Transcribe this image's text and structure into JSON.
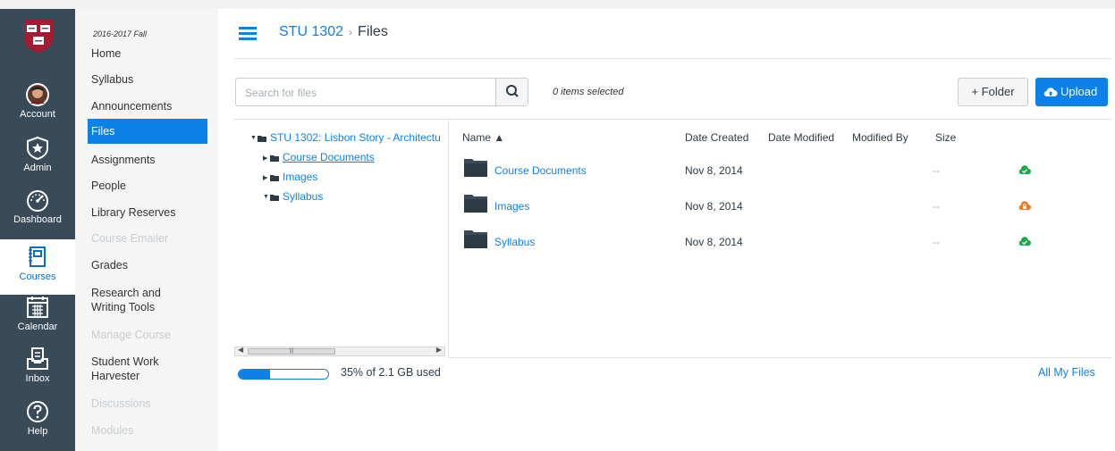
{
  "global_nav": {
    "items": [
      {
        "label": "Account",
        "icon": "avatar"
      },
      {
        "label": "Admin",
        "icon": "shield-star-icon"
      },
      {
        "label": "Dashboard",
        "icon": "speedometer-icon"
      },
      {
        "label": "Courses",
        "icon": "book-icon",
        "active": true
      },
      {
        "label": "Calendar",
        "icon": "calendar-icon"
      },
      {
        "label": "Inbox",
        "icon": "inbox-icon"
      },
      {
        "label": "Help",
        "icon": "help-icon"
      }
    ],
    "logo_text": "VE RI TAS"
  },
  "course_nav": {
    "term": "2016-2017 Fall",
    "items": [
      {
        "label": "Home"
      },
      {
        "label": "Syllabus"
      },
      {
        "label": "Announcements"
      },
      {
        "label": "Files",
        "active": true
      },
      {
        "label": "Assignments"
      },
      {
        "label": "People"
      },
      {
        "label": "Library Reserves"
      },
      {
        "label": "Course Emailer",
        "disabled": true
      },
      {
        "label": "Grades"
      },
      {
        "label": "Research and Writing Tools"
      },
      {
        "label": "Manage Course",
        "disabled": true
      },
      {
        "label": "Student Work Harvester"
      },
      {
        "label": "Discussions",
        "disabled": true
      },
      {
        "label": "Modules",
        "disabled": true
      }
    ]
  },
  "header": {
    "course": "STU 1302",
    "separator": "›",
    "page": "Files"
  },
  "toolbar": {
    "search_placeholder": "Search for files",
    "selected_text": "0 items selected",
    "folder_label": "+ Folder",
    "upload_label": "Upload"
  },
  "tree": {
    "root": "STU 1302: Lisbon Story - Architectu",
    "children": [
      "Course Documents",
      "Images",
      "Syllabus"
    ]
  },
  "table": {
    "headers": {
      "name": "Name ▲",
      "date_created": "Date Created",
      "date_modified": "Date Modified",
      "modified_by": "Modified By",
      "size": "Size"
    },
    "rows": [
      {
        "name": "Course Documents",
        "date_created": "Nov 8, 2014",
        "size": "--",
        "status": "published"
      },
      {
        "name": "Images",
        "date_created": "Nov 8, 2014",
        "size": "--",
        "status": "restricted"
      },
      {
        "name": "Syllabus",
        "date_created": "Nov 8, 2014",
        "size": "--",
        "status": "published"
      }
    ]
  },
  "footer": {
    "quota_fraction": 0.35,
    "quota_text": "35% of 2.1 GB used",
    "all_files": "All My Files"
  },
  "colors": {
    "accent": "#0e81e8",
    "nav_bg": "#394b58",
    "published": "#1aa84a",
    "restricted": "#f0781e",
    "crest": "#a51c30"
  }
}
